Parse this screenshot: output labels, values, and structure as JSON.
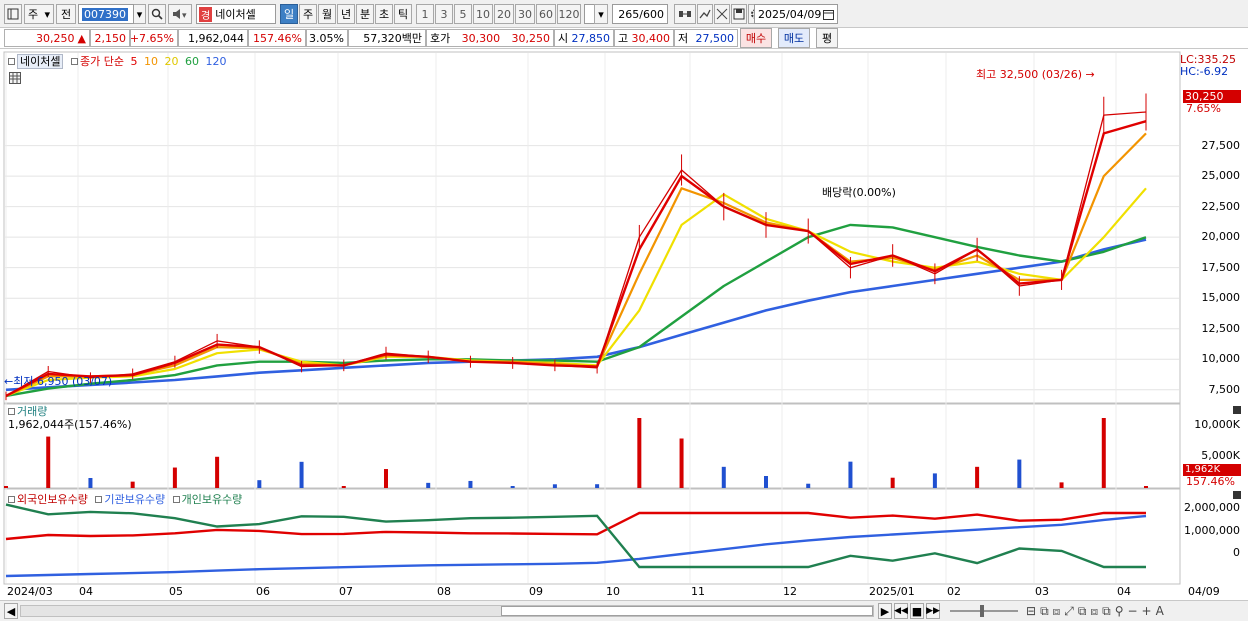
{
  "toolbar": {
    "period_main": "주",
    "prev_label": "전",
    "stock_code": "007390",
    "stock_badge": "경",
    "stock_name": "네이처셀",
    "period_tabs": [
      "일",
      "주",
      "월",
      "년",
      "분",
      "초",
      "틱"
    ],
    "active_period": "일",
    "interval_buttons": [
      "1",
      "3",
      "5",
      "10",
      "20",
      "30",
      "60",
      "120"
    ],
    "count_value": "265",
    "count_total": "/600",
    "date_value": "2025/04/09"
  },
  "quote": {
    "price": "30,250",
    "change_arrow": "▲",
    "change": "2,150",
    "change_pct": "+7.65%",
    "volume": "1,962,044",
    "volume_ratio": "157.46%",
    "turnover_pct": "3.05%",
    "trade_amount": "57,320백만",
    "ask_label": "호가",
    "ask": "30,300",
    "bid": "30,250",
    "open_label": "시",
    "open": "27,850",
    "high_label": "고",
    "high": "30,400",
    "low_label": "저",
    "low": "27,500",
    "buy_label": "매수",
    "sell_label": "매도",
    "eval_label": "평"
  },
  "price_panel": {
    "stock_label": "네이처셀",
    "ma_label": "종가 단순",
    "ma_periods": [
      "5",
      "10",
      "20",
      "60",
      "120"
    ],
    "ma_colors": [
      "#e00000",
      "#f29400",
      "#f0e000",
      "#20a040",
      "#3060e0"
    ],
    "lc_label": "LC:335.25",
    "hc_label": "HC:-6.92",
    "high_annot": "최고 32,500 (03/26)",
    "low_annot": "최저 6,950 (03/07)",
    "dividend_annot": "배당락(0.00%)",
    "current_price_tag": "30,250",
    "current_pct_tag": "7.65%",
    "y_ticks": [
      "27,500",
      "25,000",
      "22,500",
      "20,000",
      "17,500",
      "15,000",
      "12,500",
      "10,000",
      "7,500"
    ]
  },
  "volume_panel": {
    "title": "거래량",
    "value": "1,962,044주(157.46%)",
    "y_ticks": [
      "10,000K",
      "5,000K"
    ],
    "current_tag": "1,962K",
    "current_pct": "157.46%"
  },
  "holdings_panel": {
    "legend": [
      "외국인보유수량",
      "기관보유수량",
      "개인보유수량"
    ],
    "colors": [
      "#e00000",
      "#3060e0",
      "#208050"
    ],
    "y_ticks": [
      "2,000,000",
      "1,000,000",
      "0"
    ]
  },
  "x_axis": {
    "labels": [
      "2024/03",
      "04",
      "05",
      "06",
      "07",
      "08",
      "09",
      "10",
      "11",
      "12",
      "2025/01",
      "02",
      "03",
      "04"
    ],
    "right_label": "04/09"
  },
  "chart_data": {
    "type": "line",
    "title": "",
    "series": [
      {
        "name": "종가",
        "values": [
          7000,
          9000,
          8500,
          8800,
          9800,
          11500,
          11000,
          9400,
          9500,
          10500,
          10200,
          9800,
          9700,
          9500,
          9300,
          20000,
          25500,
          22500,
          21000,
          20500,
          17500,
          18500,
          17000,
          19000,
          16000,
          16500,
          30000,
          30250
        ]
      },
      {
        "name": "5",
        "values": [
          7000,
          8800,
          8600,
          8700,
          9700,
          11200,
          11000,
          9500,
          9500,
          10400,
          10200,
          9800,
          9700,
          9500,
          9400,
          19000,
          25000,
          22500,
          21000,
          20500,
          17800,
          18500,
          17200,
          19000,
          16200,
          16500,
          28500,
          29500
        ]
      },
      {
        "name": "10",
        "values": [
          7000,
          8600,
          8600,
          8700,
          9500,
          11000,
          10900,
          9600,
          9500,
          10300,
          10200,
          9800,
          9800,
          9600,
          9400,
          17000,
          24000,
          22800,
          21200,
          20500,
          18000,
          18300,
          17300,
          18500,
          16500,
          16500,
          25000,
          28500
        ]
      },
      {
        "name": "20",
        "values": [
          7000,
          8300,
          8500,
          8600,
          9200,
          10500,
          10800,
          9800,
          9500,
          10200,
          10200,
          9900,
          9800,
          9700,
          9500,
          14000,
          21000,
          23500,
          21500,
          20500,
          18800,
          18000,
          17500,
          18000,
          17000,
          16500,
          20000,
          24000
        ]
      },
      {
        "name": "60",
        "values": [
          7000,
          7600,
          8000,
          8300,
          8700,
          9500,
          9800,
          9800,
          9700,
          9900,
          10000,
          10000,
          9900,
          9900,
          9800,
          11000,
          13500,
          16000,
          18000,
          20000,
          21000,
          20800,
          20000,
          19200,
          18500,
          18000,
          18800,
          20000
        ]
      },
      {
        "name": "120",
        "values": [
          7500,
          7700,
          7900,
          8100,
          8300,
          8600,
          8900,
          9100,
          9300,
          9500,
          9700,
          9800,
          9900,
          10000,
          10200,
          11000,
          12000,
          13000,
          14000,
          14800,
          15500,
          16000,
          16500,
          17000,
          17500,
          18000,
          19000,
          19800
        ]
      }
    ],
    "ylim": [
      6500,
      35000
    ],
    "x_labels": [
      "2024/03",
      "04",
      "05",
      "06",
      "07",
      "08",
      "09",
      "10",
      "11",
      "12",
      "2025/01",
      "02",
      "03",
      "04"
    ]
  }
}
